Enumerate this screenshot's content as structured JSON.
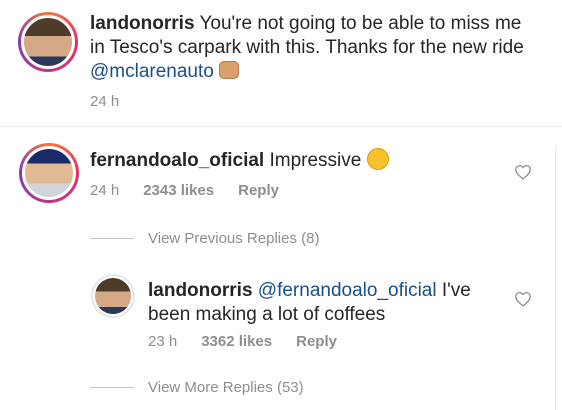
{
  "caption": {
    "username": "landonorris",
    "text": "You're not going to be able to miss me in Tesco's carpark with this. Thanks for the new ride",
    "mention": "@mclarenauto",
    "emoji_name": "fist-bump-emoji",
    "time": "24 h"
  },
  "comments": [
    {
      "username": "fernandoalo_oficial",
      "text": "Impressive",
      "emoji_name": "thinking-face-emoji",
      "time": "24 h",
      "likes": "2343 likes",
      "reply_label": "Reply",
      "view_previous_replies": "View Previous Replies (8)",
      "replies": [
        {
          "username": "landonorris",
          "mention": "@fernandoalo_oficial",
          "text": "I've been making a lot of coffees",
          "time": "23 h",
          "likes": "3362 likes",
          "reply_label": "Reply"
        }
      ],
      "view_more_replies": "View More Replies (53)"
    }
  ],
  "colors": {
    "text": "#262626",
    "muted": "#8e8e8e",
    "mention": "#1a4e8c",
    "divider": "#efefef"
  },
  "icons": {
    "like": "heart-outline-icon"
  }
}
